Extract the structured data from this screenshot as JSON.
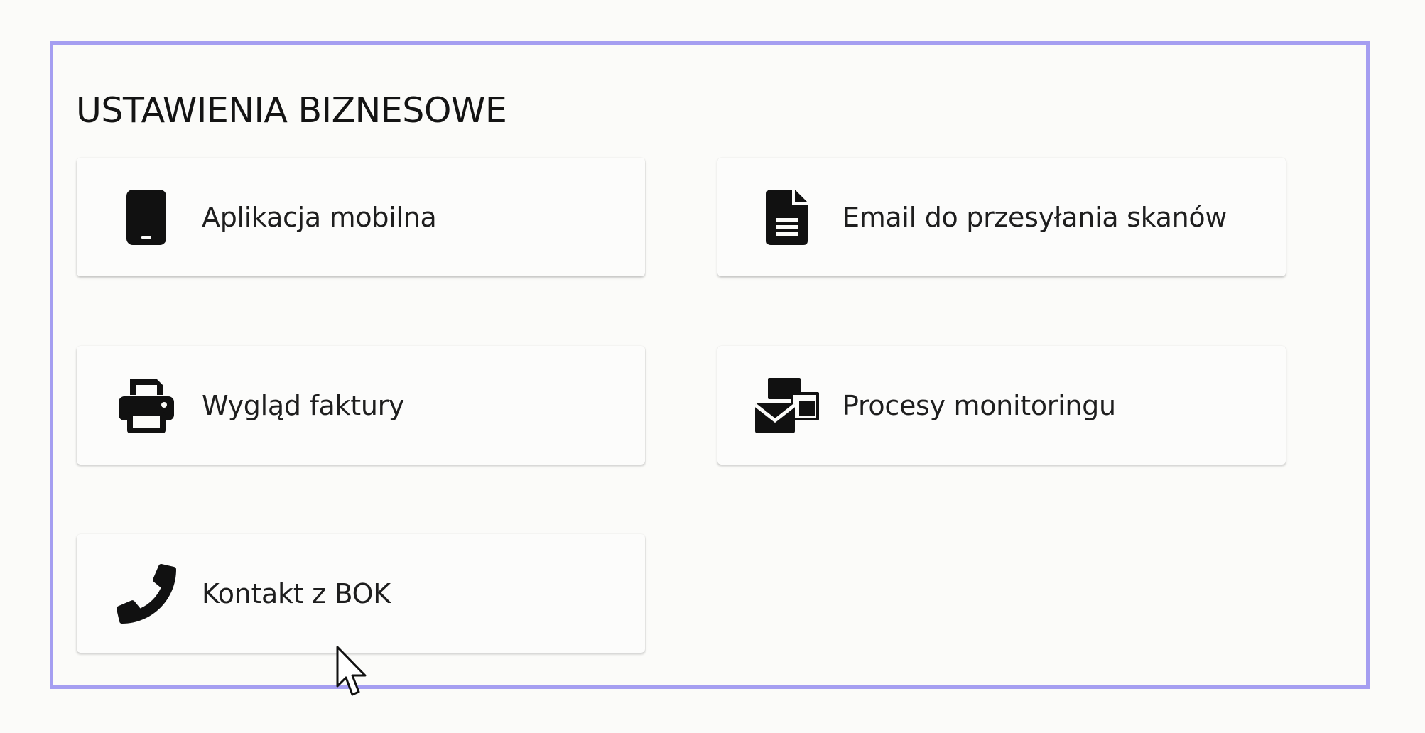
{
  "section": {
    "title": "USTAWIENIA BIZNESOWE"
  },
  "cards": [
    {
      "label": "Aplikacja mobilna",
      "icon": "mobile-phone-icon"
    },
    {
      "label": "Email do przesyłania skanów",
      "icon": "document-icon"
    },
    {
      "label": "Wygląd faktury",
      "icon": "printer-icon"
    },
    {
      "label": "Procesy monitoringu",
      "icon": "mail-bulk-icon"
    },
    {
      "label": "Kontakt z BOK",
      "icon": "phone-icon"
    }
  ],
  "colors": {
    "panel_border": "#a59ef1",
    "background": "#fbfbf9",
    "icon": "#111111"
  }
}
